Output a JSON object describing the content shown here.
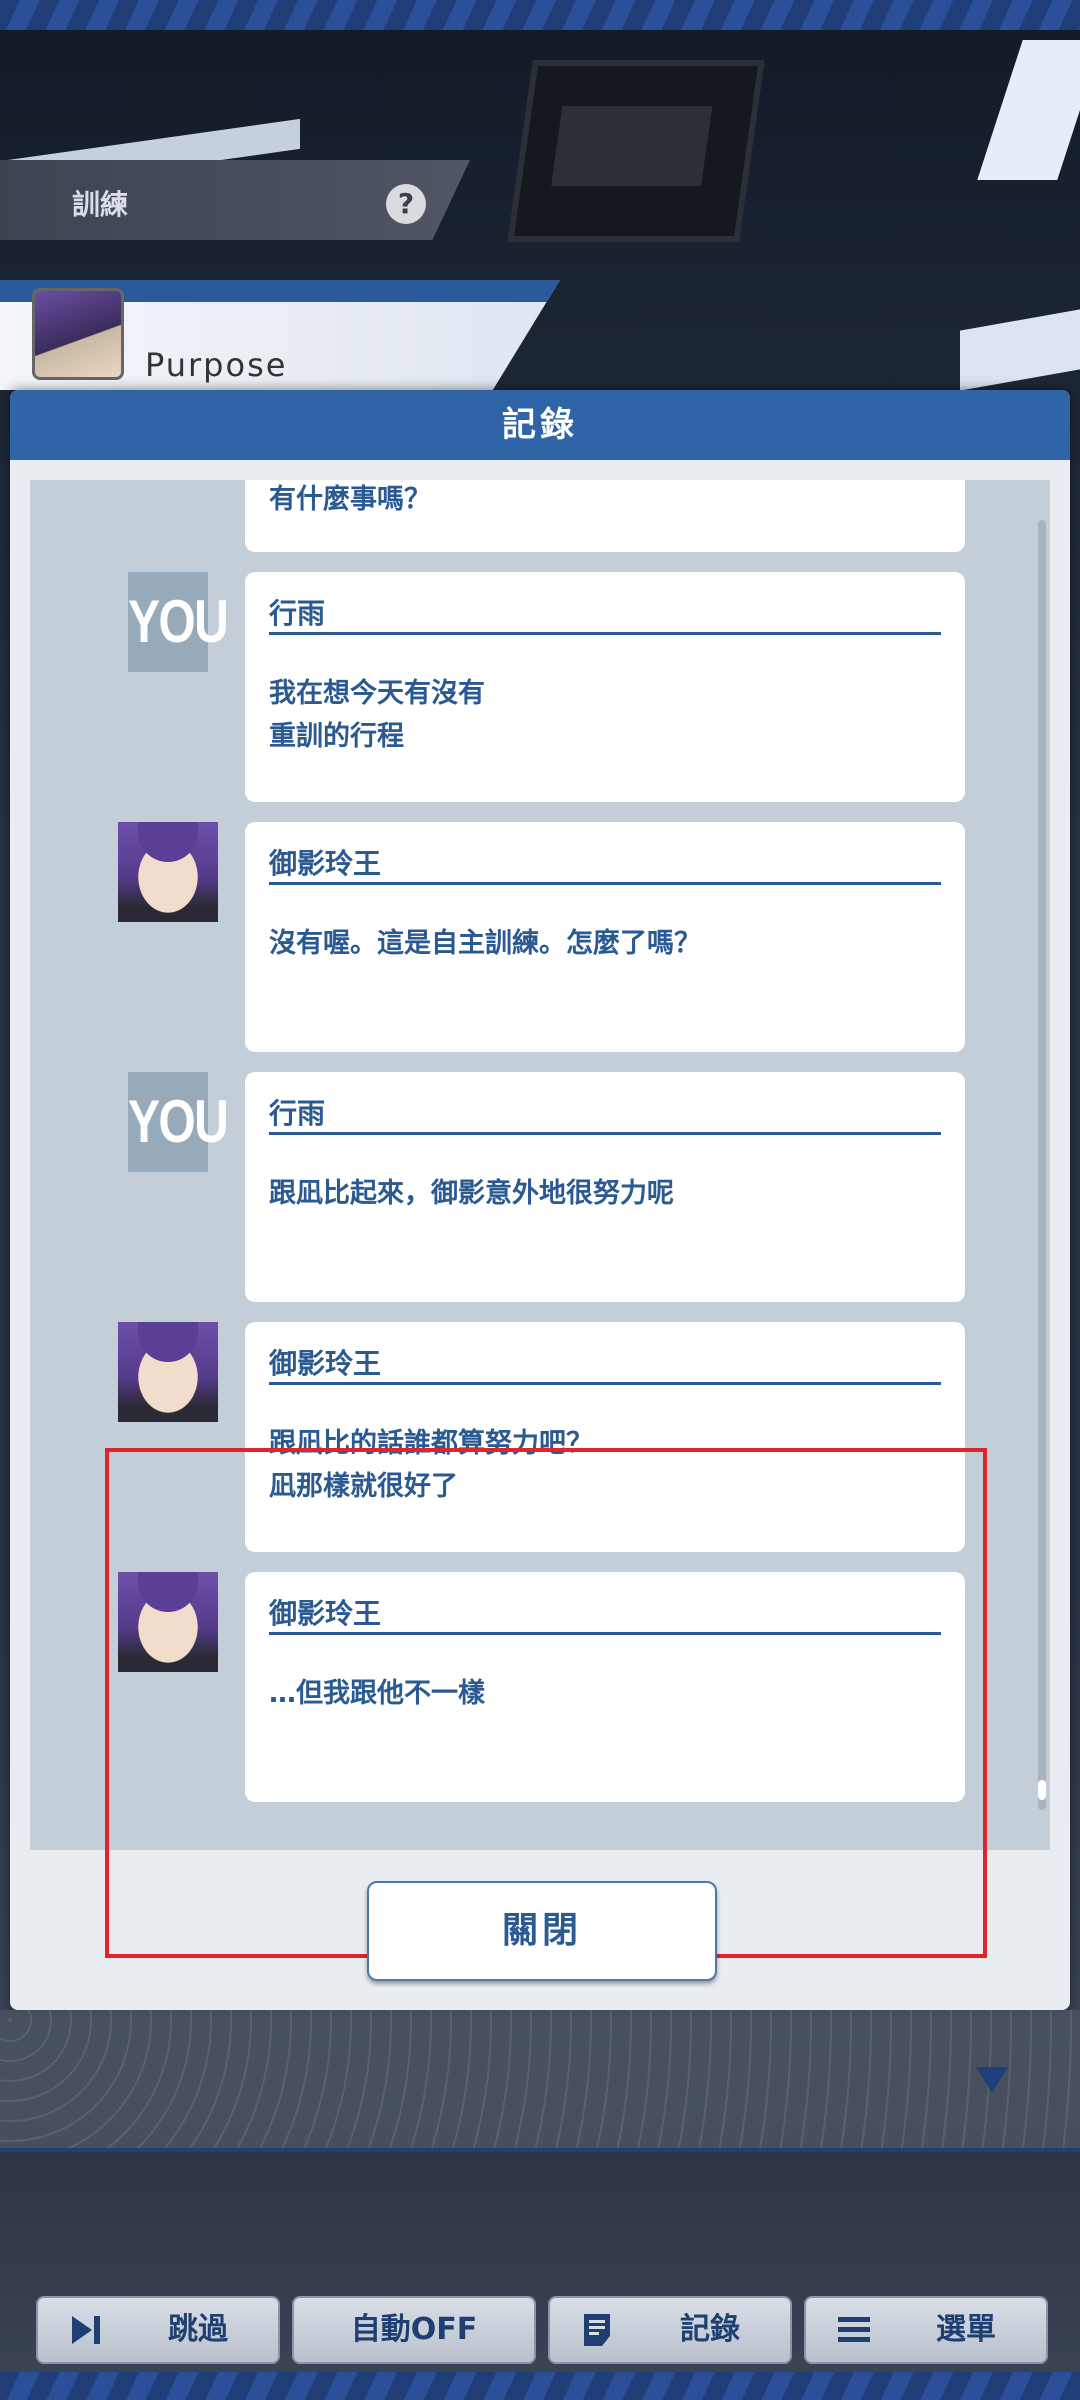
{
  "header": {
    "title": "訓練",
    "help_label": "?"
  },
  "character_bar": {
    "name": "Purpose"
  },
  "log_dialog": {
    "title": "記錄",
    "first_message": "有什麼事嗎？",
    "entries": [
      {
        "avatar_text": "YOU",
        "speaker": "行雨",
        "message": "我在想今天有沒有\n重訓的行程"
      },
      {
        "avatar_text": "",
        "speaker": "御影玲王",
        "message": "沒有喔。這是自主訓練。怎麼了嗎？"
      },
      {
        "avatar_text": "YOU",
        "speaker": "行雨",
        "message": "跟凪比起來，御影意外地很努力呢"
      },
      {
        "avatar_text": "",
        "speaker": "御影玲王",
        "message": "跟凪比的話誰都算努力吧？\n凪那樣就很好了"
      },
      {
        "avatar_text": "",
        "speaker": "御影玲王",
        "message": "…但我跟他不一樣"
      }
    ],
    "close_label": "關閉"
  },
  "bottom_nav": {
    "skip_label": "跳過",
    "auto_label": "自動OFF",
    "log_label": "記錄",
    "menu_label": "選單"
  },
  "colors": {
    "accent": "#2f64a6",
    "text": "#2b5a92",
    "highlight": "#e0242c"
  }
}
